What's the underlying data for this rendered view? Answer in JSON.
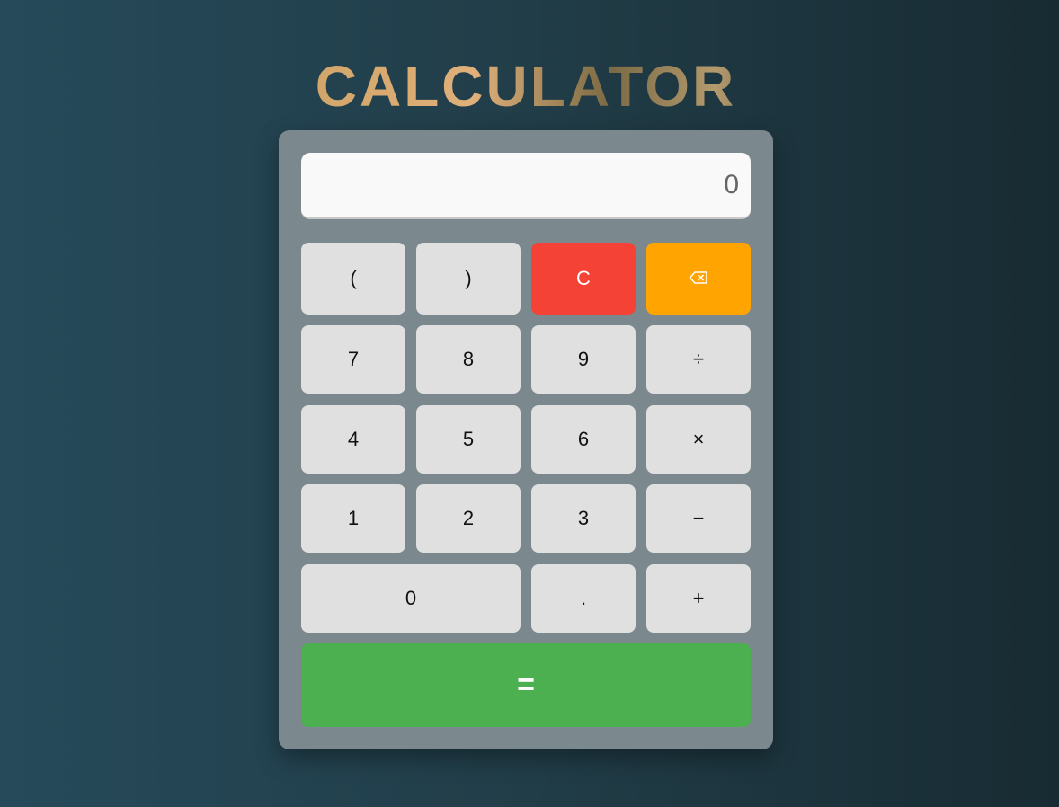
{
  "title": "CALCULATOR",
  "display": {
    "value": "0"
  },
  "keys": {
    "open_paren": "(",
    "close_paren": ")",
    "clear": "C",
    "backspace_icon": "backspace-icon",
    "seven": "7",
    "eight": "8",
    "nine": "9",
    "divide": "÷",
    "four": "4",
    "five": "5",
    "six": "6",
    "multiply": "×",
    "one": "1",
    "two": "2",
    "three": "3",
    "minus": "−",
    "zero": "0",
    "decimal": ".",
    "plus": "+",
    "equals": "="
  },
  "colors": {
    "clear": "#f44336",
    "backspace": "#ffa400",
    "equals": "#4caf50",
    "key": "#e0e0e0",
    "panel": "#7b898e"
  }
}
